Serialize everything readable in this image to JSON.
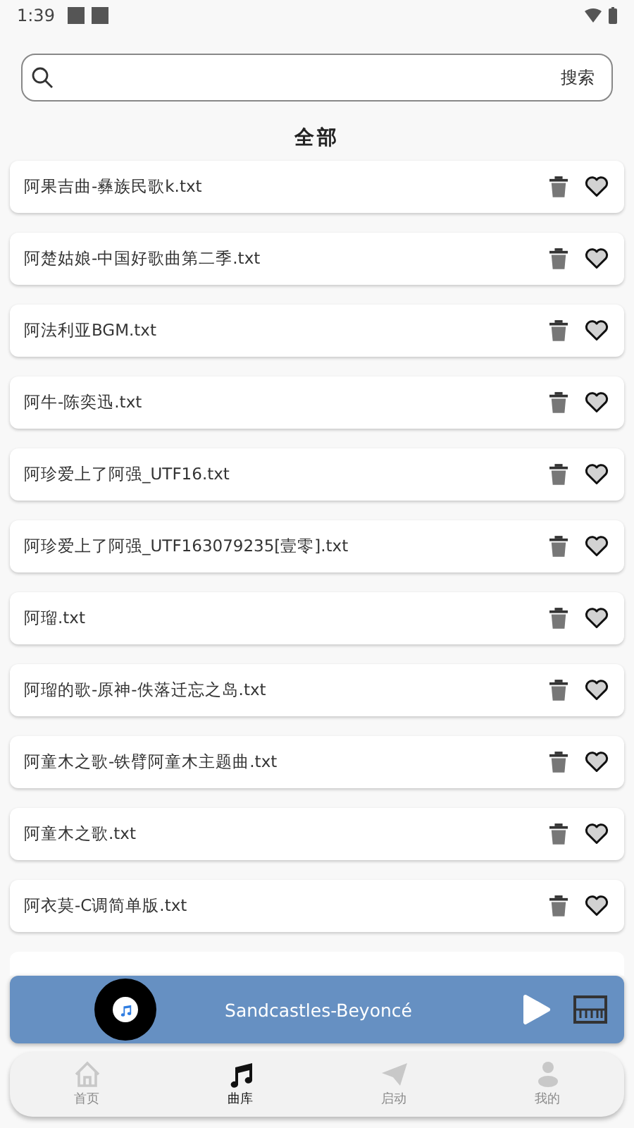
{
  "status_bar": {
    "time": "1:39"
  },
  "search": {
    "button": "搜索"
  },
  "section_title": "全部",
  "songs": [
    {
      "name": "阿果吉曲-彝族民歌k.txt"
    },
    {
      "name": "阿楚姑娘-中国好歌曲第二季.txt"
    },
    {
      "name": "阿法利亚BGM.txt"
    },
    {
      "name": "阿牛-陈奕迅.txt"
    },
    {
      "name": "阿珍爱上了阿强_UTF16.txt"
    },
    {
      "name": "阿珍爱上了阿强_UTF163079235[壹零].txt"
    },
    {
      "name": "阿瑠.txt"
    },
    {
      "name": "阿瑠的歌-原神-佚落迁忘之岛.txt"
    },
    {
      "name": "阿童木之歌-铁臂阿童木主题曲.txt"
    },
    {
      "name": "阿童木之歌.txt"
    },
    {
      "name": "阿衣莫-C调简单版.txt"
    }
  ],
  "player": {
    "title": "Sandcastles-Beyoncé"
  },
  "nav": [
    {
      "label": "首页",
      "selected": false
    },
    {
      "label": "曲库",
      "selected": true
    },
    {
      "label": "启动",
      "selected": false
    },
    {
      "label": "我的",
      "selected": false
    }
  ]
}
